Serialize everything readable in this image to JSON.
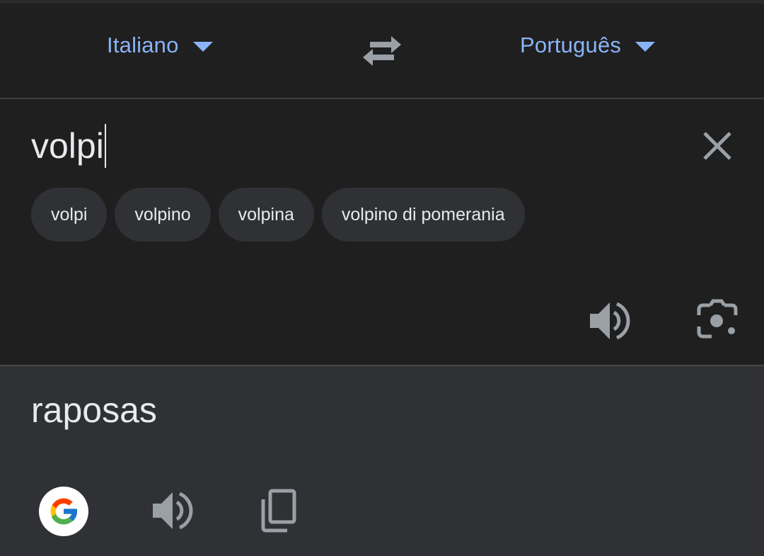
{
  "languages": {
    "source": "Italiano",
    "target": "Português"
  },
  "input": {
    "text": "volpi"
  },
  "suggestions": [
    "volpi",
    "volpino",
    "volpina",
    "volpino di pomerania"
  ],
  "output": {
    "text": "raposas"
  },
  "icons": {
    "swap": "swap-arrows-icon",
    "clear": "close-icon",
    "source_speaker": "speaker-icon",
    "camera": "camera-lens-icon",
    "google": "google-logo-icon",
    "target_speaker": "speaker-icon",
    "copy": "copy-icon"
  },
  "colors": {
    "accent": "#8ab4f8",
    "background": "#1f1f1f",
    "output_background": "#303134",
    "chip_background": "#303134",
    "text": "#e8eaed",
    "icon": "#9aa0a6"
  }
}
